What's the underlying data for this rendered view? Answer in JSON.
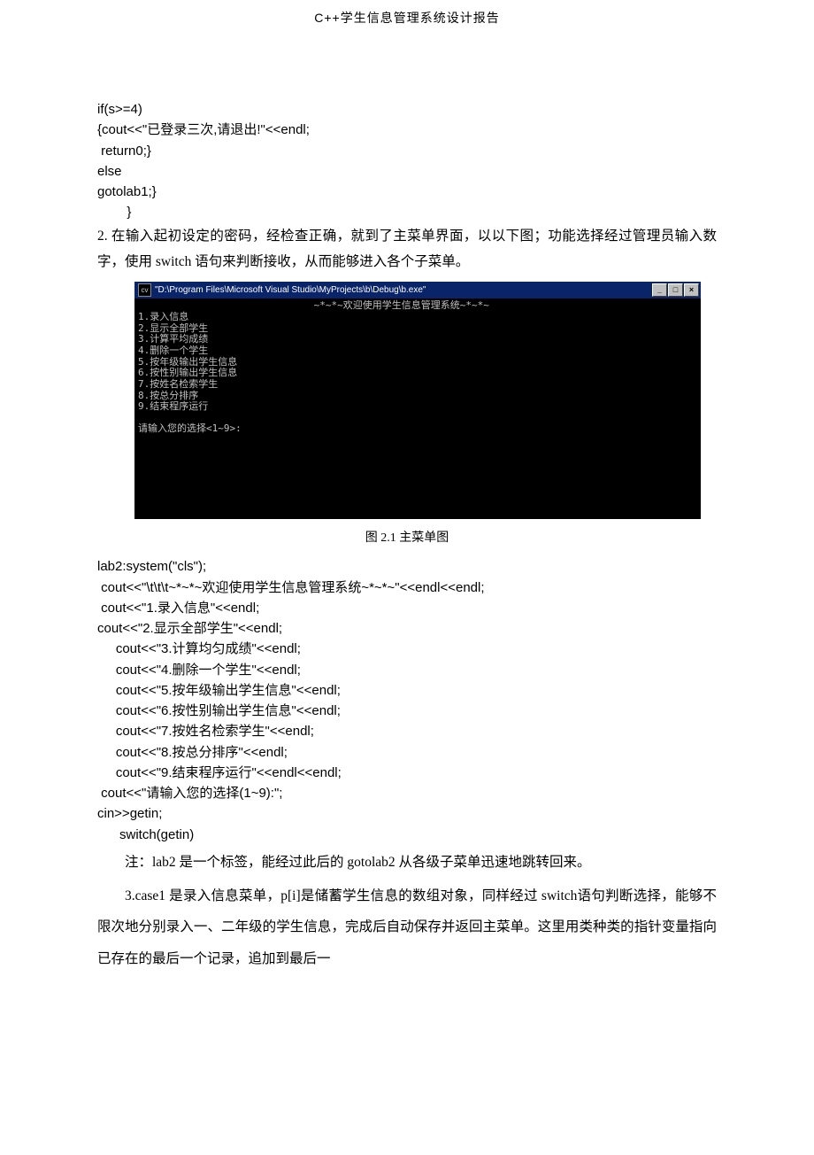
{
  "header": {
    "title": "C++学生信息管理系统设计报告"
  },
  "code1": {
    "l1": "if(s>=4)",
    "l2": "{cout<<\"已登录三次,请退出!\"<<endl;",
    "l3": " return0;}",
    "l4": "else",
    "l5": "gotolab1;}",
    "l6": "        }"
  },
  "para1": "        2. 在输入起初设定的密码，经检查正确，就到了主菜单界面，以以下图；功能选择经过管理员输入数字，使用 switch 语句来判断接收，从而能够进入各个子菜单。",
  "console": {
    "titleIcon": "cv",
    "title": "\"D:\\Program Files\\Microsoft Visual Studio\\MyProjects\\b\\Debug\\b.exe\"",
    "btnMin": "_",
    "btnMax": "□",
    "btnClose": "×",
    "welcome": "                              ~*~*~欢迎使用学生信息管理系统~*~*~",
    "m1": "1.录入信息",
    "m2": "2.显示全部学生",
    "m3": "3.计算平均成绩",
    "m4": "4.删除一个学生",
    "m5": "5.按年级输出学生信息",
    "m6": "6.按性别输出学生信息",
    "m7": "7.按姓名检索学生",
    "m8": "8.按总分排序",
    "m9": "9.结束程序运行",
    "prompt": "请输入您的选择<1~9>:"
  },
  "caption": "图 2.1 主菜单图",
  "code2": {
    "l1": "lab2:system(\"cls\");",
    "l2": " cout<<\"\\t\\t\\t~*~*~欢迎使用学生信息管理系统~*~*~\"<<endl<<endl;",
    "l3": " cout<<\"1.录入信息\"<<endl;",
    "l4": "cout<<\"2.显示全部学生\"<<endl;",
    "l5": "     cout<<\"3.计算均匀成绩\"<<endl;",
    "l6": "     cout<<\"4.删除一个学生\"<<endl;",
    "l7": "     cout<<\"5.按年级输出学生信息\"<<endl;",
    "l8": "     cout<<\"6.按性别输出学生信息\"<<endl;",
    "l9": "     cout<<\"7.按姓名检索学生\"<<endl;",
    "l10": "     cout<<\"8.按总分排序\"<<endl;",
    "l11": "     cout<<\"9.结束程序运行\"<<endl<<endl;",
    "l12": " cout<<\"请输入您的选择(1~9):\";",
    "l13": "cin>>getin;",
    "l14": "      switch(getin)"
  },
  "para2": "注：lab2 是一个标签，能经过此后的 gotolab2 从各级子菜单迅速地跳转回来。",
  "para3": "3.case1 是录入信息菜单，p[i]是储蓄学生信息的数组对象，同样经过 switch语句判断选择，能够不限次地分别录入一、二年级的学生信息，完成后自动保存并返回主菜单。这里用类种类的指针变量指向已存在的最后一个记录，追加到最后一"
}
